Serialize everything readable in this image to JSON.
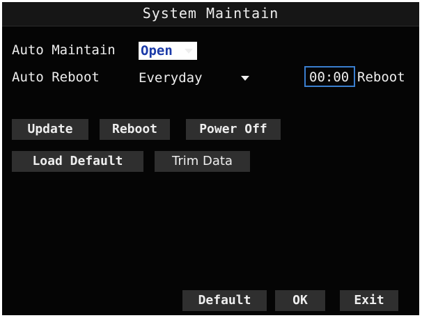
{
  "window": {
    "title": "System Maintain"
  },
  "auto_maintain": {
    "label": "Auto Maintain",
    "value": "Open"
  },
  "auto_reboot": {
    "label": "Auto Reboot",
    "value": "Everyday",
    "time": "00:00",
    "suffix": "Reboot"
  },
  "actions": {
    "update": "Update",
    "reboot": "Reboot",
    "power_off": "Power Off",
    "load_default": "Load Default",
    "trim_data": "Trim Data"
  },
  "footer": {
    "default": "Default",
    "ok": "OK",
    "exit": "Exit"
  },
  "colors": {
    "background": "#050505",
    "text": "#eeeeee",
    "selected_text": "#1b3aa8",
    "focus_border": "#3a7fd0",
    "button": "#2f2f2f"
  },
  "icons": {
    "dropdown": "triangle-down"
  }
}
